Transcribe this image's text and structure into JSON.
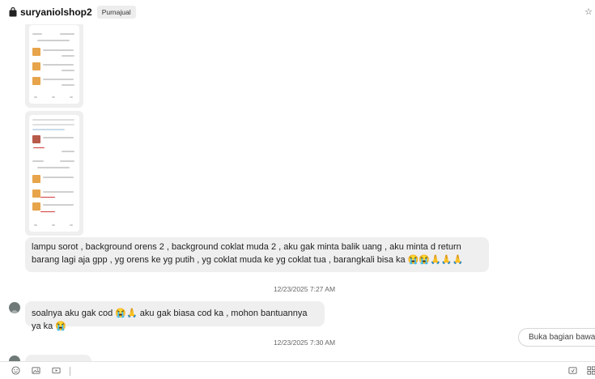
{
  "header": {
    "shop_name": "suryaniolshop2",
    "badge": "Purnajual",
    "star_icon": "star-icon"
  },
  "messages": [
    {
      "type": "text",
      "text": "lampu sorot , background orens 2 , background coklat muda 2 ,  aku gak minta balik uang , aku minta d return barang lagi aja gpp ,  yg orens ke yg putih , yg coklat muda ke yg coklat tua , barangkali bisa ka 😭😭🙏🙏🙏"
    },
    {
      "type": "timestamp",
      "text": "12/23/2025 7:27 AM"
    },
    {
      "type": "text",
      "text": "soalnya aku gak cod 😭🙏 aku gak biasa cod ka , mohon bantuannya ya ka 😭"
    },
    {
      "type": "timestamp",
      "text": "12/23/2025 7:30 AM"
    }
  ],
  "scroll_button": "Buka bagian bawah",
  "footer": {
    "icons": [
      "emoji-icon",
      "image-icon",
      "video-icon",
      "send-product-icon",
      "menu-grid-icon"
    ]
  }
}
